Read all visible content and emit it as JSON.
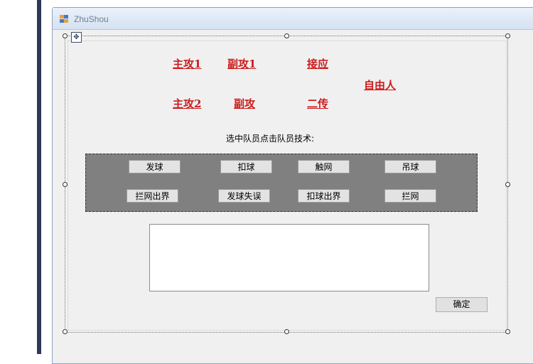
{
  "window": {
    "title": "ZhuShou"
  },
  "players": [
    {
      "key": "main1",
      "label": "主攻1"
    },
    {
      "key": "sub1",
      "label": "副攻1"
    },
    {
      "key": "libero_receive",
      "label": "接应"
    },
    {
      "key": "libero",
      "label": "自由人"
    },
    {
      "key": "main2",
      "label": "主攻2"
    },
    {
      "key": "sub2",
      "label": "副攻"
    },
    {
      "key": "setter",
      "label": "二传"
    }
  ],
  "hint": "选中队员点击队员技术:",
  "techniques": [
    {
      "label": "发球"
    },
    {
      "label": "扣球"
    },
    {
      "label": "触网"
    },
    {
      "label": "吊球"
    },
    {
      "label": "拦网出界"
    },
    {
      "label": "发球失误"
    },
    {
      "label": "扣球出界"
    },
    {
      "label": "拦网"
    }
  ],
  "output": {
    "value": ""
  },
  "confirm_label": "确定",
  "colors": {
    "player_text": "#cc1b1b",
    "panel_bg": "#808080",
    "form_bg": "#f0f0f0"
  }
}
